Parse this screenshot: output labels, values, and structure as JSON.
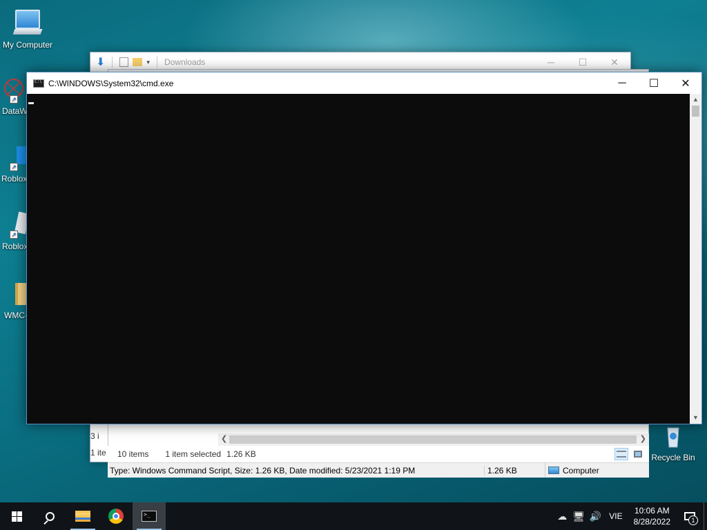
{
  "desktop": {
    "icons": [
      {
        "label": "My Computer"
      },
      {
        "label": "DataW"
      },
      {
        "label": "Roblox"
      },
      {
        "label": "Roblox"
      },
      {
        "label": "WMC-"
      },
      {
        "label": "Recycle Bin"
      }
    ]
  },
  "explorer": {
    "title": "Downloads",
    "left_partial_count": "3 i",
    "left_partial_sel": "1 ite",
    "status": {
      "item_count": "10 items",
      "selected": "1 item selected",
      "selected_size": "1.26 KB"
    },
    "details": {
      "type_info": "Type: Windows Command Script, Size: 1.26 KB, Date modified: 5/23/2021 1:19 PM",
      "size": "1.26 KB",
      "location": "Computer"
    }
  },
  "cmd": {
    "title": "C:\\WINDOWS\\System32\\cmd.exe",
    "minimize": "─",
    "maximize": "☐",
    "close": "✕"
  },
  "taskbar": {
    "language": "VIE",
    "time": "10:06 AM",
    "date": "8/28/2022",
    "notification_count": "1"
  }
}
